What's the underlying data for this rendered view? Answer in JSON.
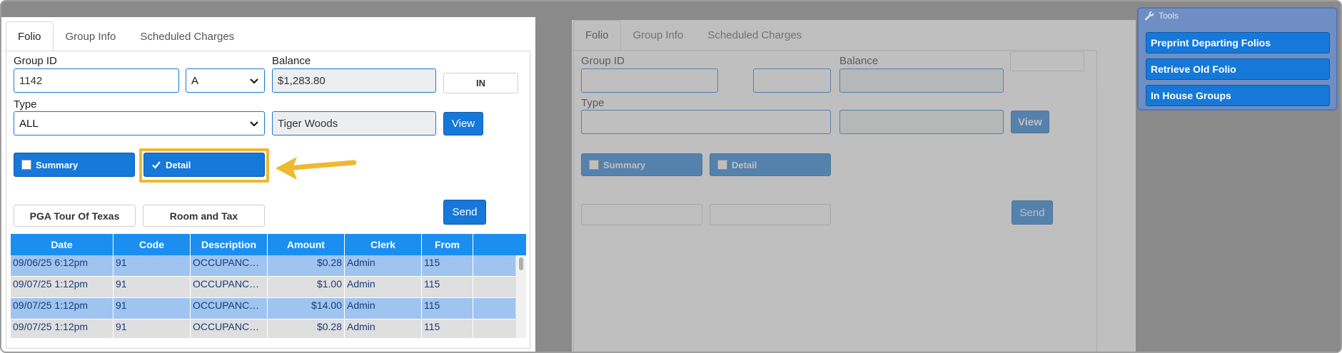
{
  "tabs": [
    "Folio",
    "Group Info",
    "Scheduled Charges"
  ],
  "form": {
    "group_id_label": "Group ID",
    "group_id_value": "1142",
    "group_letter": "A",
    "balance_label": "Balance",
    "balance_value": "$1,283.80",
    "status_button": "IN",
    "type_label": "Type",
    "type_value": "ALL",
    "name_value": "Tiger Woods",
    "view_button": "View",
    "summary_label": "Summary",
    "detail_label": "Detail",
    "pga_button": "PGA Tour Of Texas",
    "room_tax_button": "Room and Tax",
    "send_button": "Send"
  },
  "table": {
    "columns": [
      "Date",
      "Code",
      "Description",
      "Amount",
      "Clerk",
      "From",
      ""
    ],
    "rows": [
      [
        "09/06/25 6:12pm",
        "91",
        "OCCUPANCY ...",
        "$0.28",
        "Admin",
        "115"
      ],
      [
        "09/07/25 1:12pm",
        "91",
        "OCCUPANCY ...",
        "$1.00",
        "Admin",
        "115"
      ],
      [
        "09/07/25 1:12pm",
        "91",
        "OCCUPANCY ...",
        "$14.00",
        "Admin",
        "115"
      ],
      [
        "09/07/25 1:12pm",
        "91",
        "OCCUPANCY ...",
        "$0.28",
        "Admin",
        "115"
      ]
    ]
  },
  "bg_form": {
    "tabs": [
      "Folio",
      "Group Info",
      "Scheduled Charges"
    ],
    "group_id_label": "Group ID",
    "balance_label": "Balance",
    "type_label": "Type",
    "view_button": "View",
    "summary_label": "Summary",
    "detail_label": "Detail",
    "send_button": "Send"
  },
  "tools": {
    "title": "Tools",
    "items": [
      "Preprint Departing Folios",
      "Retrieve Old Folio",
      "In House Groups"
    ]
  },
  "colors": {
    "accent": "#1678d8",
    "highlight": "#f0b82d",
    "table_header": "#1a8ff0",
    "selected_row": "#9fc4f0"
  }
}
